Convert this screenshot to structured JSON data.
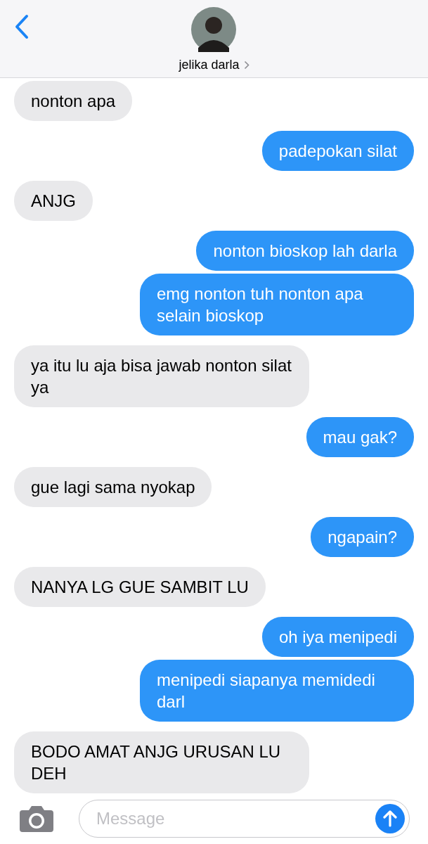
{
  "header": {
    "contact_name": "jelika darla"
  },
  "messages": [
    {
      "text": "nonton apa",
      "outgoing": false
    },
    {
      "text": "padepokan silat",
      "outgoing": true
    },
    {
      "text": "ANJG",
      "outgoing": false
    },
    {
      "text": "nonton bioskop lah darla",
      "outgoing": true
    },
    {
      "text": "emg nonton tuh nonton apa selain bioskop",
      "outgoing": true
    },
    {
      "text": "ya itu lu aja bisa jawab nonton silat ya",
      "outgoing": false
    },
    {
      "text": "mau gak?",
      "outgoing": true
    },
    {
      "text": "gue lagi sama nyokap",
      "outgoing": false
    },
    {
      "text": "ngapain?",
      "outgoing": true
    },
    {
      "text": "NANYA LG GUE SAMBIT LU",
      "outgoing": false
    },
    {
      "text": "oh iya menipedi",
      "outgoing": true
    },
    {
      "text": "menipedi siapanya memidedi darl",
      "outgoing": true
    },
    {
      "text": "BODO AMAT ANJG URUSAN LU DEH",
      "outgoing": false
    }
  ],
  "composer": {
    "placeholder": "Message"
  }
}
